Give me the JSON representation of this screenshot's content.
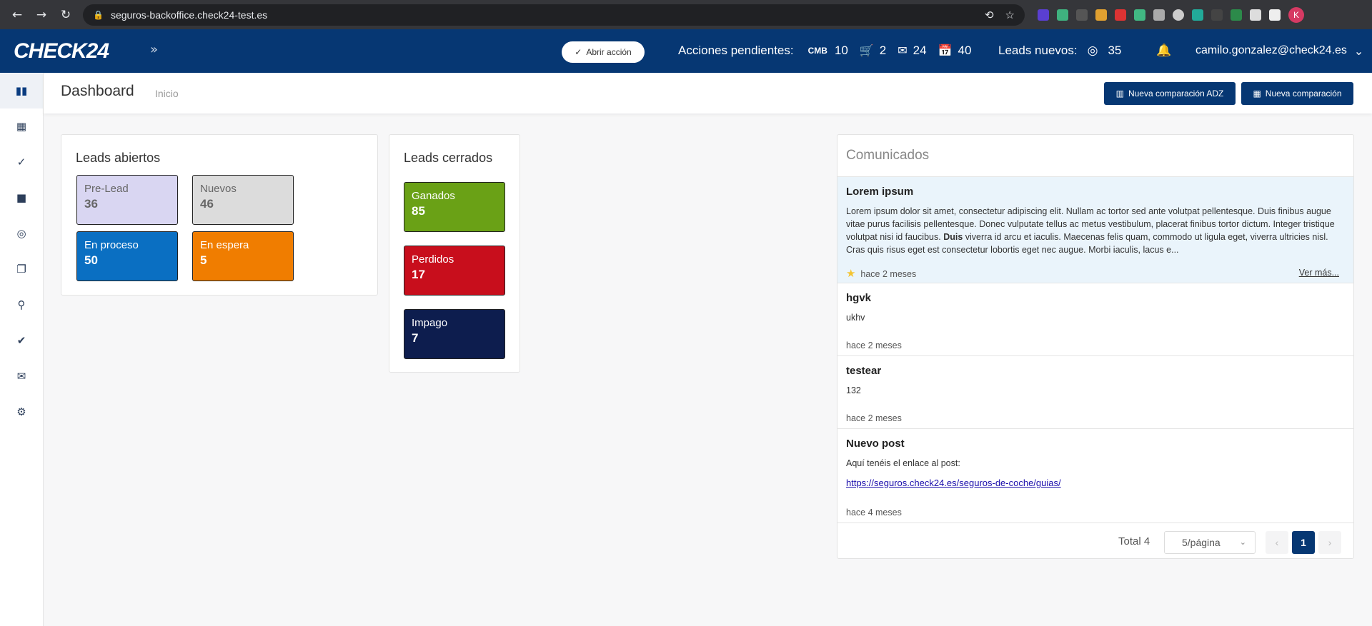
{
  "browser": {
    "url": "seguros-backoffice.check24-test.es",
    "profile_initial": "K"
  },
  "header": {
    "logo": "CHECK24",
    "abrir_accion": "Abrir acción",
    "pending_label": "Acciones pendientes:",
    "cmb_label": "CMB",
    "cmb_count": "10",
    "cart_count": "2",
    "mail_count": "24",
    "calendar_count": "40",
    "leads_label": "Leads nuevos:",
    "leads_count": "35",
    "user_email": "camilo.gonzalez@check24.es"
  },
  "page": {
    "title": "Dashboard",
    "breadcrumb": "Inicio",
    "btn_adz": "Nueva comparación ADZ",
    "btn_new": "Nueva comparación"
  },
  "leads_abiertos": {
    "title": "Leads abiertos",
    "tiles": [
      {
        "label": "Pre-Lead",
        "value": "36"
      },
      {
        "label": "Nuevos",
        "value": "46"
      },
      {
        "label": "En proceso",
        "value": "50"
      },
      {
        "label": "En espera",
        "value": "5"
      }
    ]
  },
  "leads_cerrados": {
    "title": "Leads cerrados",
    "tiles": [
      {
        "label": "Ganados",
        "value": "85"
      },
      {
        "label": "Perdidos",
        "value": "17"
      },
      {
        "label": "Impago",
        "value": "7"
      }
    ]
  },
  "comunicados": {
    "title": "Comunicados",
    "posts": [
      {
        "title": "Lorem ipsum",
        "body_1": "Lorem ipsum dolor sit amet, consectetur adipiscing elit. Nullam ac tortor sed ante volutpat pellentesque. Duis finibus augue vitae purus facilisis pellentesque. Donec vulputate tellus ac metus vestibulum, placerat finibus tortor dictum. Integer tristique volutpat nisi id faucibus. ",
        "body_bold": "Duis",
        "body_2": " viverra id arcu et iaculis. Maecenas felis quam, commodo ut ligula eget, viverra ultricies nisl. Cras quis risus eget est consectetur lobortis eget nec augue. Morbi iaculis, lacus e...",
        "time": "hace 2 meses",
        "ver_mas": "Ver más..."
      },
      {
        "title": "hgvk",
        "body": "ukhv",
        "time": "hace 2 meses"
      },
      {
        "title": "testear",
        "body": "132",
        "time": "hace 2 meses"
      },
      {
        "title": "Nuevo post",
        "body": "Aquí tenéis el enlace al post:",
        "link": "https://seguros.check24.es/seguros-de-coche/guias/",
        "time": "hace 4 meses"
      }
    ],
    "total": "Total 4",
    "per_page": "5/página",
    "current_page": "1"
  },
  "colors": {
    "brand": "#063773",
    "pre_lead": "#d9d6f2",
    "nuevos": "#dcdcdc",
    "en_proceso": "#0a6fc2",
    "en_espera": "#f07d00",
    "ganados": "#6aa116",
    "perdidos": "#c80e1c",
    "impago": "#0d1d4e",
    "highlight_post": "#eaf4fb"
  }
}
